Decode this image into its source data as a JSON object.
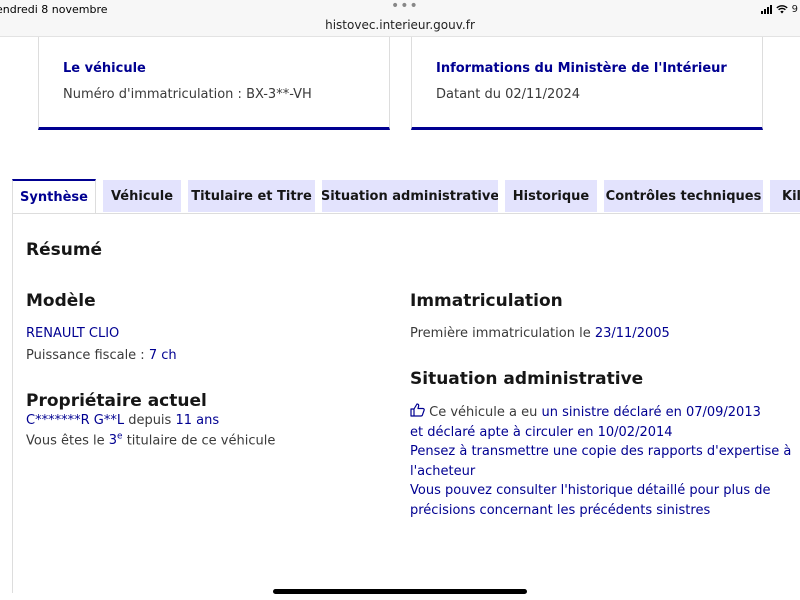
{
  "status_bar": {
    "date": "endredi 8 novembre",
    "battery": "9",
    "url": "histovec.interieur.gouv.fr"
  },
  "cards": [
    {
      "title": "Le véhicule",
      "text": "Numéro d'immatriculation : BX-3**-VH"
    },
    {
      "title": "Informations du Ministère de l'Intérieur",
      "text": "Datant du 02/11/2024"
    }
  ],
  "tabs": [
    {
      "label": "Synthèse",
      "active": true
    },
    {
      "label": "Véhicule"
    },
    {
      "label": "Titulaire et Titre"
    },
    {
      "label": "Situation administrative"
    },
    {
      "label": "Historique"
    },
    {
      "label": "Contrôles techniques"
    },
    {
      "label": "Kilo"
    }
  ],
  "summary": {
    "title": "Résumé",
    "model": {
      "heading": "Modèle",
      "name": "RENAULT CLIO",
      "power_label": "Puissance fiscale : ",
      "power_value": "7 ch"
    },
    "owner": {
      "heading": "Propriétaire actuel",
      "name": "C*******R G**L",
      "since_label": " depuis ",
      "since_value": "11 ans",
      "rank_prefix": "Vous êtes le ",
      "rank_number": "3",
      "rank_sup": "e",
      "rank_suffix": " titulaire de ce véhicule"
    },
    "registration": {
      "heading": "Immatriculation",
      "label": "Première immatriculation le ",
      "date": "23/11/2005"
    },
    "admin": {
      "heading": "Situation administrative",
      "line1_prefix": "Ce véhicule a eu ",
      "line1_link": "un sinistre déclaré en 07/09/2013",
      "line2_prefix": "et ",
      "line2_link": "déclaré apte à circuler en 10/02/2014",
      "line3": "Pensez à transmettre une copie des rapports d'expertise à",
      "line4": "l'acheteur",
      "line5": "Vous pouvez consulter l'historique détaillé pour plus de",
      "line6": "précisions concernant les précédents sinistres"
    }
  },
  "colors": {
    "accent": "#000091",
    "tab_bg": "#e3e3fd",
    "text": "#161616",
    "muted": "#3a3a3a"
  }
}
